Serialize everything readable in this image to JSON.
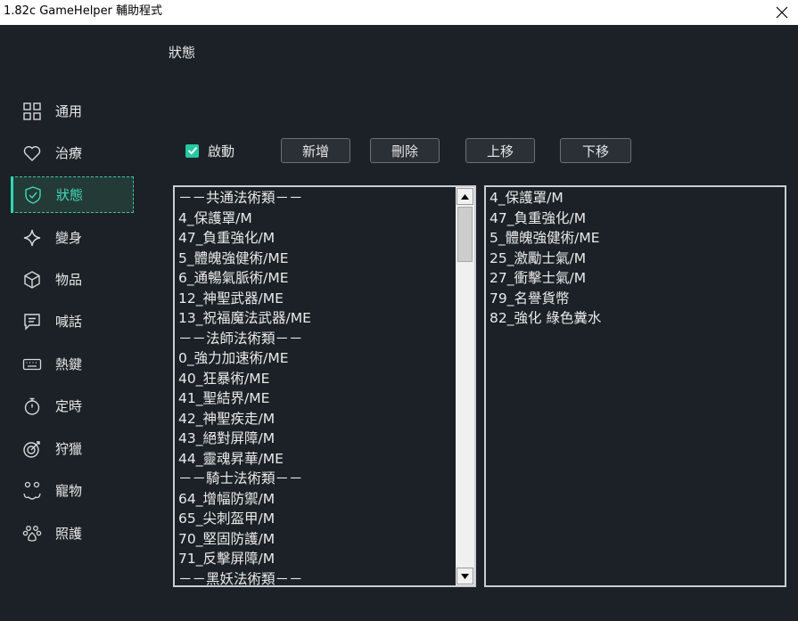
{
  "window": {
    "title": "1.82c GameHelper 輔助程式"
  },
  "page": {
    "title": "狀態"
  },
  "sidebar": {
    "items": [
      {
        "label": "通用",
        "icon": "grid-icon"
      },
      {
        "label": "治療",
        "icon": "heart-icon"
      },
      {
        "label": "狀態",
        "icon": "shield-icon",
        "active": true
      },
      {
        "label": "變身",
        "icon": "sparkle-icon"
      },
      {
        "label": "物品",
        "icon": "cube-icon"
      },
      {
        "label": "喊話",
        "icon": "chat-icon"
      },
      {
        "label": "熱鍵",
        "icon": "keyboard-icon"
      },
      {
        "label": "定時",
        "icon": "stopwatch-icon"
      },
      {
        "label": "狩獵",
        "icon": "target-icon"
      },
      {
        "label": "寵物",
        "icon": "pet-face-icon"
      },
      {
        "label": "照護",
        "icon": "paw-icon"
      }
    ]
  },
  "toolbar": {
    "enable_label": "啟動",
    "enable_checked": true,
    "add_label": "新增",
    "delete_label": "刪除",
    "move_up_label": "上移",
    "move_down_label": "下移"
  },
  "available_list": [
    "－－共通法術類－－",
    "4_保護罩/M",
    "47_負重強化/M",
    "5_體魄強健術/ME",
    "6_通暢氣脈術/ME",
    "12_神聖武器/ME",
    "13_祝福魔法武器/ME",
    "－－法師法術類－－",
    "0_強力加速術/ME",
    "40_狂暴術/ME",
    "41_聖結界/ME",
    "42_神聖疾走/M",
    "43_絕對屏障/M",
    "44_靈魂昇華/ME",
    "－－騎士法術類－－",
    "64_增幅防禦/M",
    "65_尖刺盔甲/M",
    "70_堅固防護/M",
    "71_反擊屏障/M",
    "－－黑妖法術類－－"
  ],
  "selected_list": [
    "4_保護罩/M",
    "47_負重強化/M",
    "5_體魄強健術/ME",
    "25_激勵士氣/M",
    "27_衝擊士氣/M",
    "79_名譽貨幣",
    "82_強化 綠色糞水"
  ],
  "colors": {
    "accent": "#2fd8b5",
    "background": "#1b2126",
    "checkbox": "#25c7a3"
  }
}
